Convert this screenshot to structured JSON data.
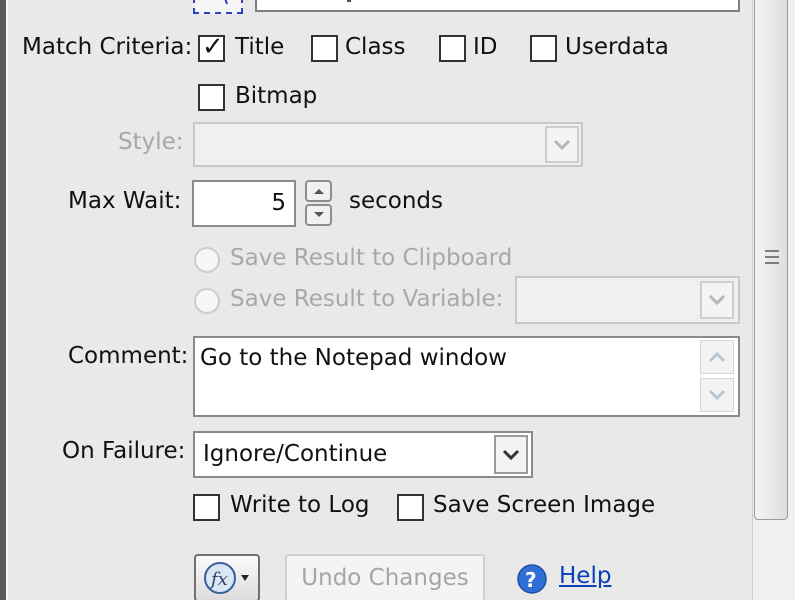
{
  "match_criteria": {
    "label": "Match Criteria:",
    "options": [
      {
        "label": "Title",
        "checked": true
      },
      {
        "label": "Class",
        "checked": false
      },
      {
        "label": "ID",
        "checked": false
      },
      {
        "label": "Userdata",
        "checked": false
      },
      {
        "label": "Bitmap",
        "checked": false
      }
    ]
  },
  "style": {
    "label": "Style:",
    "value": ""
  },
  "max_wait": {
    "label": "Max Wait:",
    "value": "5",
    "unit": "seconds"
  },
  "save_result": {
    "clipboard_label": "Save Result to Clipboard",
    "variable_label": "Save Result to Variable:",
    "variable_value": ""
  },
  "comment": {
    "label": "Comment:",
    "value": "Go to the Notepad window"
  },
  "on_failure": {
    "label": "On Failure:",
    "value": "Ignore/Continue",
    "options": [
      {
        "label": "Write to Log",
        "checked": false
      },
      {
        "label": "Save Screen Image",
        "checked": false
      }
    ]
  },
  "footer": {
    "undo_label": "Undo Changes",
    "help_label": "Help"
  },
  "colors": {
    "link": "#0b3fb5",
    "disabled_text": "#a8a8a8",
    "panel": "#e9e9e9"
  }
}
